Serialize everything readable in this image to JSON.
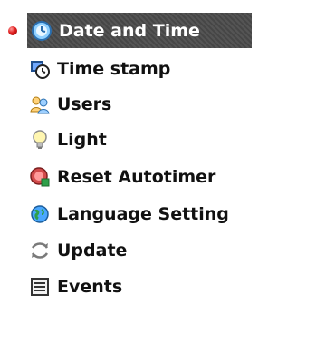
{
  "menu": {
    "items": [
      {
        "label": "Date and Time",
        "icon": "clock-icon",
        "active": true
      },
      {
        "label": "Time stamp",
        "icon": "time-stamp-icon"
      },
      {
        "label": "Users",
        "icon": "users-icon"
      },
      {
        "label": "Light",
        "icon": "light-bulb-icon"
      },
      {
        "label": "Reset Autotimer",
        "icon": "reset-autotimer-icon"
      },
      {
        "label": "Language Setting",
        "icon": "globe-icon"
      },
      {
        "label": "Update",
        "icon": "update-icon"
      },
      {
        "label": "Events",
        "icon": "events-list-icon"
      }
    ]
  },
  "colors": {
    "active_background": "#4a4a4a",
    "bullet": "#e02020"
  }
}
